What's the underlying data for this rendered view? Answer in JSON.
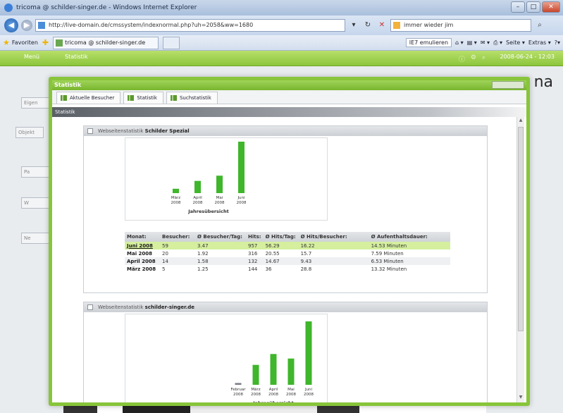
{
  "window": {
    "title": "tricoma @ schilder-singer.de - Windows Internet Explorer",
    "buttons": {
      "minimize": "–",
      "maximize": "□",
      "close": "✕"
    }
  },
  "addressbar": {
    "url": "http://live-domain.de/cmssystem/indexnormal.php?uh=2058&ww=1680",
    "search_value": "immer wieder jim"
  },
  "favorites": {
    "label": "Favoriten",
    "tab_title": "tricoma @ schilder-singer.de",
    "emulate": "IE7 emulieren",
    "seite": "Seite ▾",
    "extras": "Extras ▾"
  },
  "cms": {
    "menu": "Menü",
    "statistik": "Statistik",
    "date": "2008-06-24 - 12:03"
  },
  "background": {
    "logo": "na",
    "side_items": [
      "Eigen",
      "Objekt",
      "",
      "Pa",
      "W",
      "Ne"
    ]
  },
  "modal": {
    "title": "Statistik",
    "tabs": [
      "Aktuelle Besucher",
      "Statistik",
      "Suchstatistik"
    ],
    "section_title": "Statistik"
  },
  "panel1": {
    "prefix": "Webseitenstatistik",
    "site": "Schilder Spezial",
    "chart_caption": "Jahresübersicht"
  },
  "panel2": {
    "prefix": "Webseitenstatistik",
    "site": "schilder-singer.de",
    "chart_caption": "Jahresübersicht"
  },
  "table": {
    "headers": [
      "Monat:",
      "Besucher:",
      "Ø Besucher/Tag:",
      "Hits:",
      "Ø Hits/Tag:",
      "Ø Hits/Besucher:",
      "Ø Aufenthaltsdauer:"
    ],
    "rows": [
      [
        "Juni 2008",
        "59",
        "3.47",
        "957",
        "56.29",
        "16.22",
        "14.53 Minuten"
      ],
      [
        "Mai 2008",
        "20",
        "1.92",
        "316",
        "20.55",
        "15.7",
        "7.59 Minuten"
      ],
      [
        "April 2008",
        "14",
        "1.58",
        "132",
        "14.67",
        "9.43",
        "6.53 Minuten"
      ],
      [
        "März 2008",
        "5",
        "1.25",
        "144",
        "36",
        "28.8",
        "13.32 Minuten"
      ]
    ]
  },
  "chart_data": [
    {
      "type": "bar",
      "title": "Jahresübersicht",
      "categories": [
        "März 2008",
        "April 2008",
        "Mai 2008",
        "Juni 2008"
      ],
      "values": [
        5,
        14,
        20,
        59
      ],
      "color": "#3fb62b"
    },
    {
      "type": "bar",
      "title": "Jahresübersicht",
      "categories": [
        "Februar 2008",
        "März 2008",
        "April 2008",
        "Mai 2008",
        "Juni 2008"
      ],
      "values": [
        2,
        22,
        34,
        29,
        70
      ],
      "color": "#3fb62b"
    }
  ],
  "colors": {
    "accent": "#88c53a",
    "bar": "#3fb62b",
    "highlight_row": "#d5ef9e"
  }
}
